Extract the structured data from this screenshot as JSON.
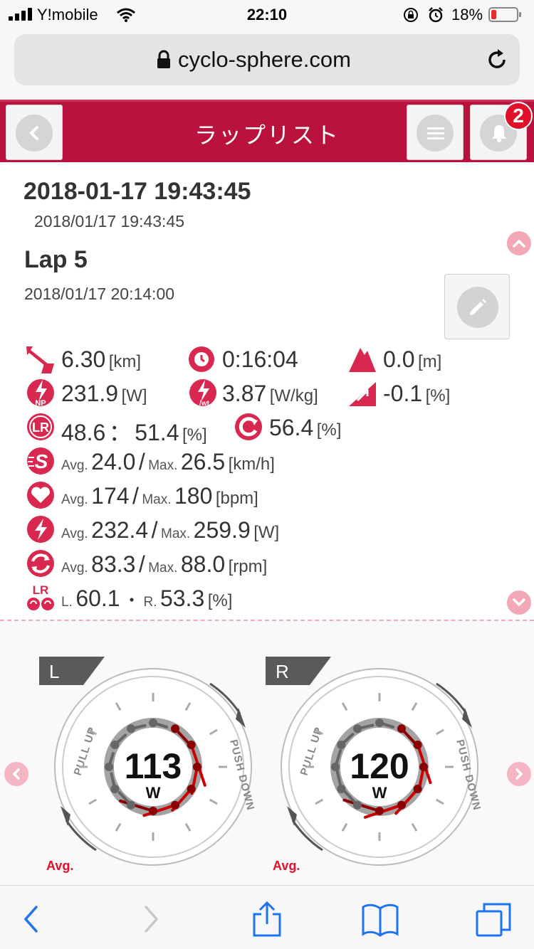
{
  "status_bar": {
    "carrier": "Y!mobile",
    "time": "22:10",
    "battery_pct": "18%"
  },
  "browser": {
    "url": "cyclo-sphere.com"
  },
  "header": {
    "title": "ラップリスト",
    "notification_count": "2"
  },
  "ride": {
    "title": "2018-01-17 19:43:45",
    "subtitle": "2018/01/17 19:43:45"
  },
  "lap": {
    "title": "Lap 5",
    "time": "2018/01/17 20:14:00"
  },
  "stats": {
    "distance": {
      "value": "6.30",
      "unit": "[km]"
    },
    "duration": {
      "value": "0:16:04"
    },
    "elevation": {
      "value": "0.0",
      "unit": "[m]"
    },
    "np": {
      "value": "231.9",
      "unit": "[W]"
    },
    "pwr_weight": {
      "value": "3.87",
      "unit": "[W/kg]"
    },
    "gradient": {
      "value": "-0.1",
      "unit": "[%]"
    },
    "lr_balance": {
      "left": "48.6",
      "sep": "：",
      "right": "51.4",
      "unit": "[%]"
    },
    "efficiency": {
      "value": "56.4",
      "unit": "[%]"
    },
    "speed": {
      "avg_label": "Avg.",
      "avg": "24.0",
      "slash": "/",
      "max_label": "Max.",
      "max": "26.5",
      "unit": "[km/h]"
    },
    "heart_rate": {
      "avg_label": "Avg.",
      "avg": "174",
      "slash": "/",
      "max_label": "Max.",
      "max": "180",
      "unit": "[bpm]"
    },
    "power": {
      "avg_label": "Avg.",
      "avg": "232.4",
      "slash": "/",
      "max_label": "Max.",
      "max": "259.9",
      "unit": "[W]"
    },
    "cadence": {
      "avg_label": "Avg.",
      "avg": "83.3",
      "slash": "/",
      "max_label": "Max.",
      "max": "88.0",
      "unit": "[rpm]"
    },
    "lr_efficiency": {
      "l_label": "L.",
      "left": "60.1",
      "dot": "・",
      "r_label": "R.",
      "right": "53.3",
      "unit": "[%]"
    }
  },
  "pedal_gauges": {
    "left": {
      "tag": "L",
      "value": "113",
      "unit": "W",
      "avg_label": "Avg.",
      "pull_label": "PULL UP",
      "push_label": "PUSH DOWN"
    },
    "right": {
      "tag": "R",
      "value": "120",
      "unit": "W",
      "avg_label": "Avg.",
      "pull_label": "PULL UP",
      "push_label": "PUSH DOWN"
    }
  },
  "colors": {
    "brand": "#b8123d",
    "icon": "#d9284f",
    "vector_red": "#cc0000",
    "accent_pink": "#f3a8b8"
  },
  "icons": {
    "distance": "distance-icon",
    "time": "clock-icon",
    "elevation": "mountain-icon",
    "np": "np-icon",
    "pwr_weight": "pwr-weight-icon",
    "gradient": "gradient-icon",
    "lr": "lr-balance-icon",
    "efficiency": "efficiency-icon",
    "speed": "speed-icon",
    "heart": "heart-icon",
    "power": "power-icon",
    "cadence": "cadence-icon",
    "lr_cadence": "lr-efficiency-icon"
  }
}
